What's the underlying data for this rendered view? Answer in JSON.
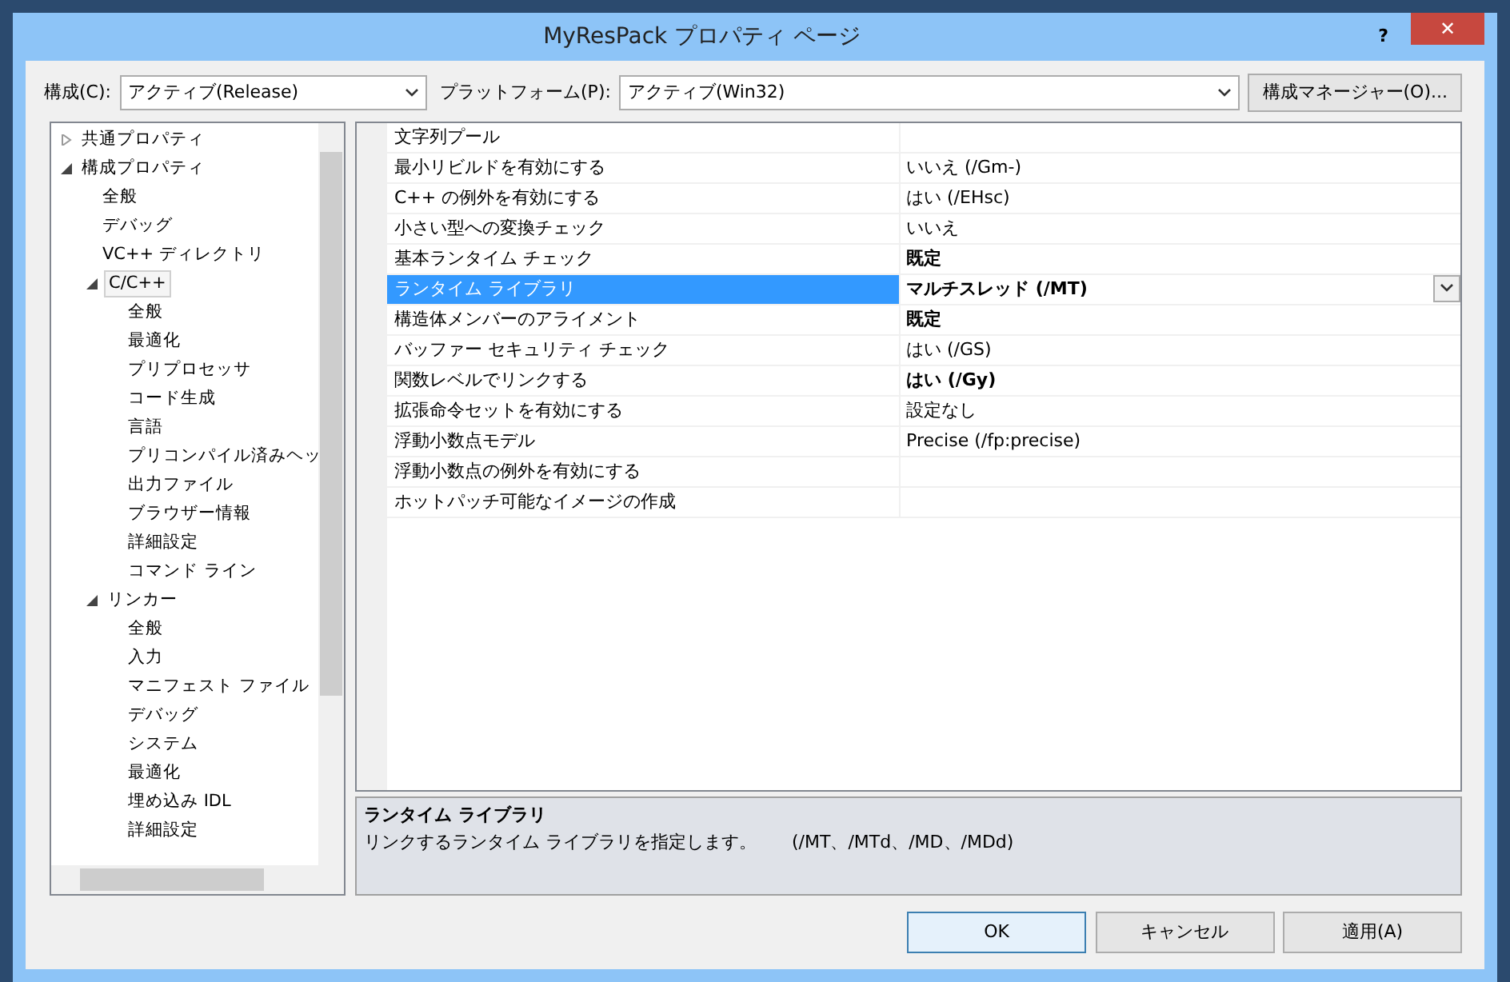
{
  "window": {
    "title": "MyResPack プロパティ ページ",
    "help": "?",
    "close": "✕"
  },
  "toolbar": {
    "configuration_label": "構成(C):",
    "configuration": "アクティブ(Release)",
    "platform_label": "プラットフォーム(P):",
    "platform": "アクティブ(Win32)",
    "manager_button": "構成マネージャー(O)..."
  },
  "tree": [
    {
      "label": "共通プロパティ",
      "expanded": false,
      "selected": false
    },
    {
      "label": "構成プロパティ",
      "expanded": true,
      "selected": false,
      "children": [
        {
          "label": "全般",
          "selected": false
        },
        {
          "label": "デバッグ",
          "selected": false
        },
        {
          "label": "VC++ ディレクトリ",
          "selected": false
        },
        {
          "label": "C/C++",
          "expanded": true,
          "selected": true,
          "children": [
            {
              "label": "全般",
              "selected": false
            },
            {
              "label": "最適化",
              "selected": false
            },
            {
              "label": "プリプロセッサ",
              "selected": false
            },
            {
              "label": "コード生成",
              "selected": false
            },
            {
              "label": "言語",
              "selected": false
            },
            {
              "label": "プリコンパイル済みヘッ",
              "selected": false
            },
            {
              "label": "出力ファイル",
              "selected": false
            },
            {
              "label": "ブラウザー情報",
              "selected": false
            },
            {
              "label": "詳細設定",
              "selected": false
            },
            {
              "label": "コマンド ライン",
              "selected": false
            }
          ]
        },
        {
          "label": "リンカー",
          "expanded": true,
          "selected": false,
          "children": [
            {
              "label": "全般",
              "selected": false
            },
            {
              "label": "入力",
              "selected": false
            },
            {
              "label": "マニフェスト ファイル",
              "selected": false
            },
            {
              "label": "デバッグ",
              "selected": false
            },
            {
              "label": "システム",
              "selected": false
            },
            {
              "label": "最適化",
              "selected": false
            },
            {
              "label": "埋め込み IDL",
              "selected": false
            },
            {
              "label": "詳細設定",
              "selected": false
            }
          ]
        }
      ]
    }
  ],
  "properties": [
    {
      "name": "文字列プール",
      "selected": false
    },
    {
      "name": "最小リビルドを有効にする",
      "value": "いいえ (/Gm-)",
      "bold": false,
      "selected": false
    },
    {
      "name": "C++ の例外を有効にする",
      "value": "はい (/EHsc)",
      "bold": false,
      "selected": false
    },
    {
      "name": "小さい型への変換チェック",
      "value": "いいえ",
      "bold": false,
      "selected": false
    },
    {
      "name": "基本ランタイム チェック",
      "value": "既定",
      "bold": true,
      "selected": false
    },
    {
      "name": "ランタイム ライブラリ",
      "value": "マルチスレッド (/MT)",
      "bold": true,
      "selected": true
    },
    {
      "name": "構造体メンバーのアライメント",
      "value": "既定",
      "bold": true,
      "selected": false
    },
    {
      "name": "バッファー セキュリティ チェック",
      "value": "はい (/GS)",
      "bold": false,
      "selected": false
    },
    {
      "name": "関数レベルでリンクする",
      "value": "はい (/Gy)",
      "bold": true,
      "selected": false
    },
    {
      "name": "拡張命令セットを有効にする",
      "value": "設定なし",
      "bold": false,
      "selected": false
    },
    {
      "name": "浮動小数点モデル",
      "value": "Precise (/fp:precise)",
      "bold": false,
      "selected": false
    },
    {
      "name": "浮動小数点の例外を有効にする",
      "selected": false
    },
    {
      "name": "ホットパッチ可能なイメージの作成",
      "selected": false
    }
  ],
  "description": {
    "title": "ランタイム ライブラリ",
    "text": "リンクするランタイム ライブラリを指定します。　　(/MT、/MTd、/MD、/MDd)"
  },
  "buttons": [
    {
      "label": "OK",
      "default": true
    },
    {
      "label": "キャンセル",
      "default": false
    },
    {
      "label": "適用(A)",
      "default": false
    }
  ]
}
